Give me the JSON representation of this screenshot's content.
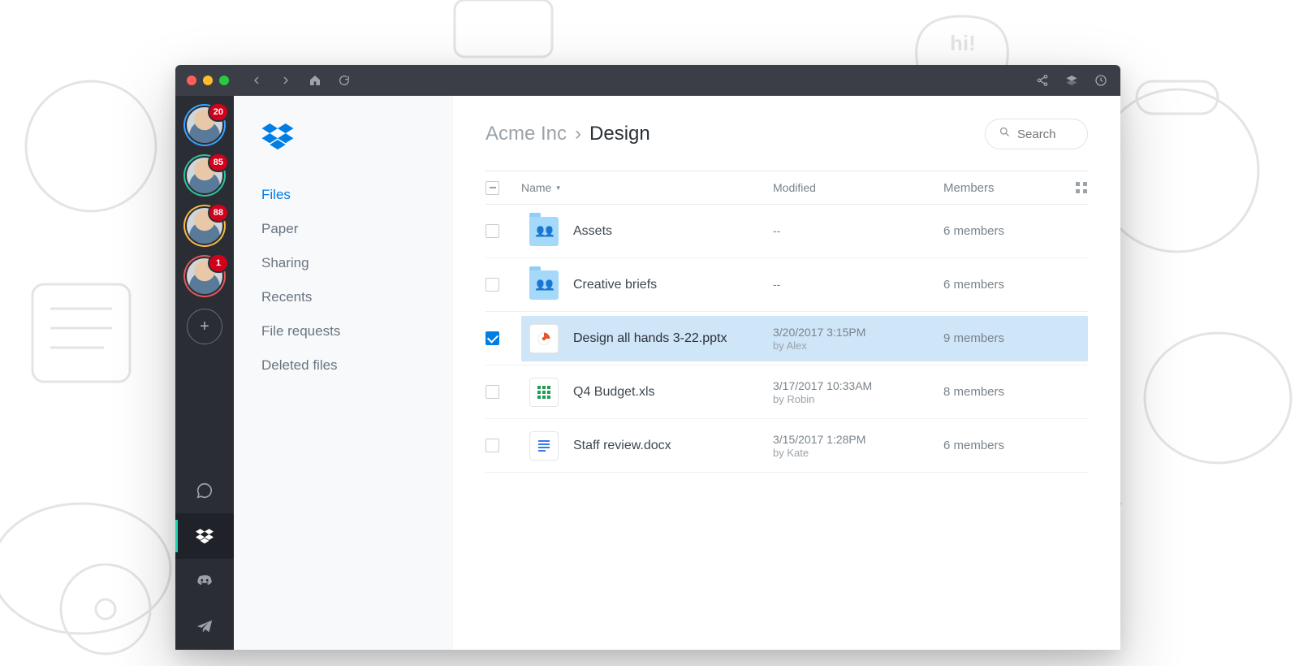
{
  "titlebar": {
    "icons": [
      "back",
      "forward",
      "home",
      "reload",
      "share",
      "layers",
      "history"
    ]
  },
  "servers": {
    "avatars": [
      {
        "badge": "20",
        "ring": "#3aa3ff"
      },
      {
        "badge": "85",
        "ring": "#2fc39a"
      },
      {
        "badge": "88",
        "ring": "#f5b942"
      },
      {
        "badge": "1",
        "ring": "#e05a5a"
      }
    ],
    "apps": [
      "whatsapp",
      "dropbox",
      "discord",
      "telegram"
    ],
    "active_app_index": 1
  },
  "dropbox": {
    "nav": {
      "items": [
        "Files",
        "Paper",
        "Sharing",
        "Recents",
        "File requests",
        "Deleted files"
      ],
      "active_index": 0
    },
    "breadcrumb": {
      "parent": "Acme Inc",
      "current": "Design"
    },
    "search": {
      "placeholder": "Search"
    },
    "columns": {
      "name": "Name",
      "modified": "Modified",
      "members": "Members"
    },
    "rows": [
      {
        "icon": "folder",
        "checked": false,
        "name": "Assets",
        "modified": "--",
        "by": "",
        "members": "6 members"
      },
      {
        "icon": "folder",
        "checked": false,
        "name": "Creative briefs",
        "modified": "--",
        "by": "",
        "members": "6 members"
      },
      {
        "icon": "pptx",
        "checked": true,
        "name": "Design all hands 3-22.pptx",
        "modified": "3/20/2017 3:15PM",
        "by": "by Alex",
        "members": "9 members"
      },
      {
        "icon": "xls",
        "checked": false,
        "name": "Q4 Budget.xls",
        "modified": "3/17/2017 10:33AM",
        "by": "by Robin",
        "members": "8 members"
      },
      {
        "icon": "docx",
        "checked": false,
        "name": "Staff review.docx",
        "modified": "3/15/2017 1:28PM",
        "by": "by Kate",
        "members": "6 members"
      }
    ]
  }
}
